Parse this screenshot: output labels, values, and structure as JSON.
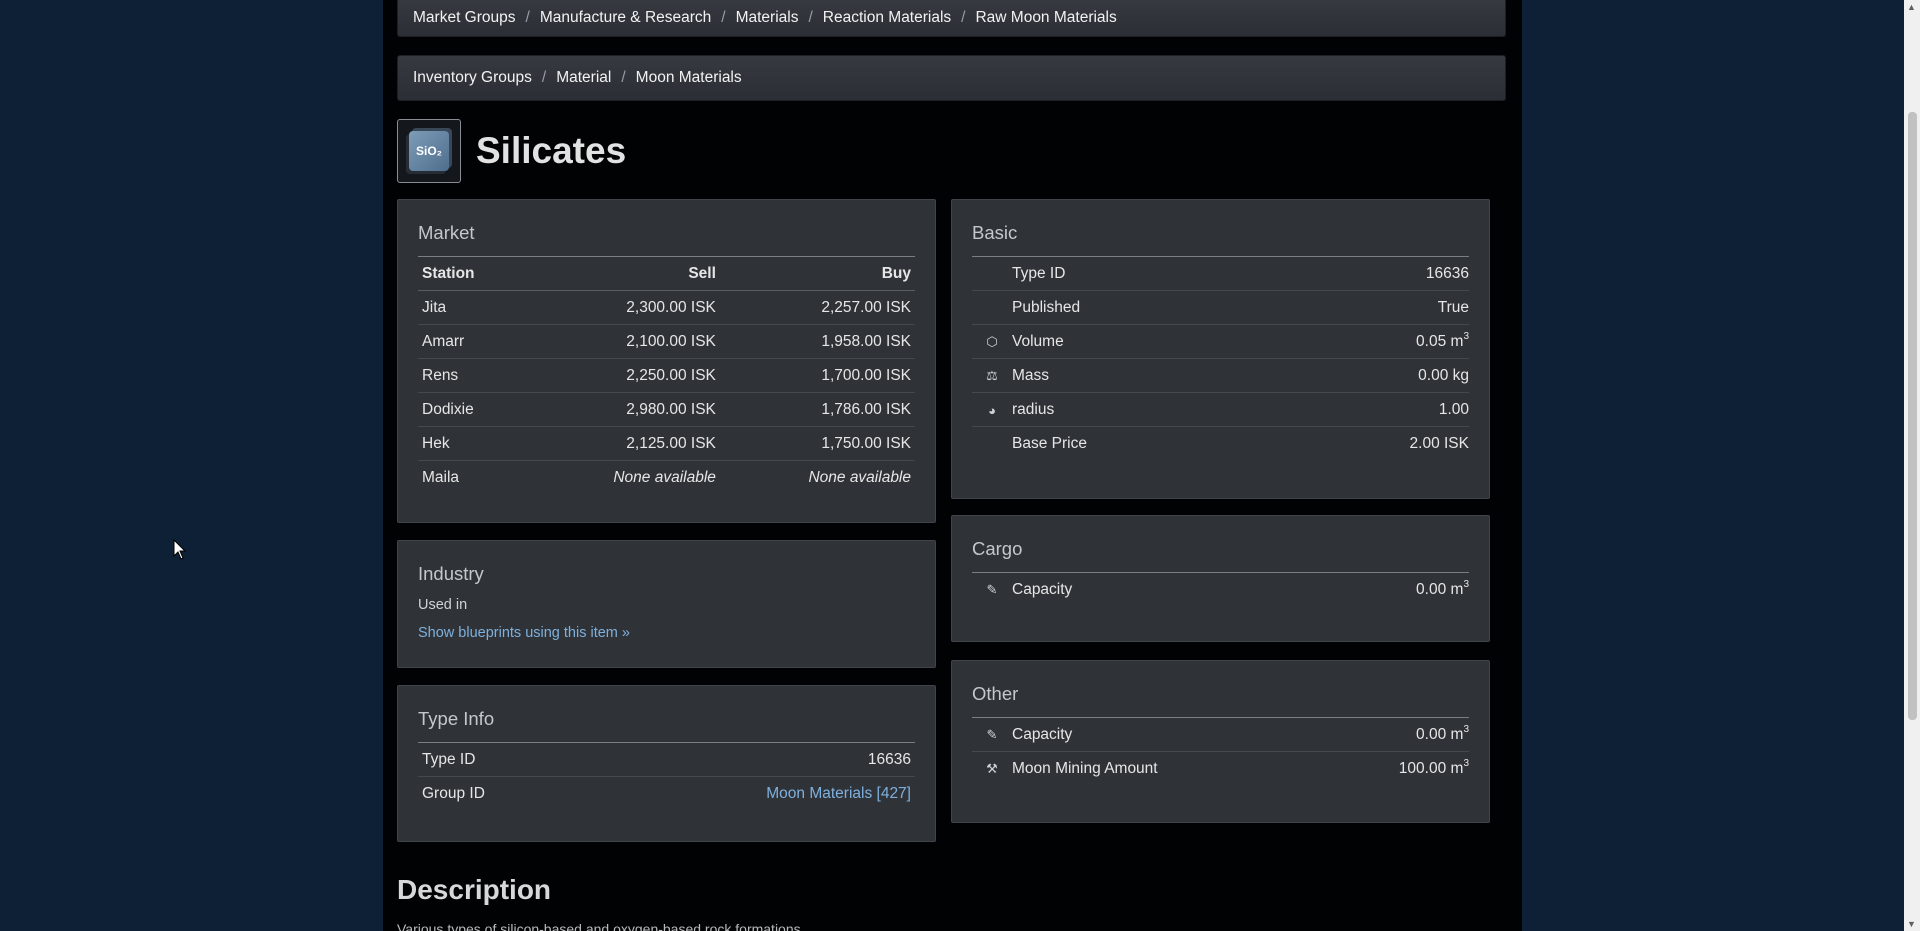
{
  "breadcrumb_market": [
    "Market Groups",
    "Manufacture & Research",
    "Materials",
    "Reaction Materials",
    "Raw Moon Materials"
  ],
  "breadcrumb_inventory": [
    "Inventory Groups",
    "Material",
    "Moon Materials"
  ],
  "item": {
    "title": "Silicates",
    "icon_label": "SiO₂"
  },
  "market": {
    "heading": "Market",
    "columns": {
      "station": "Station",
      "sell": "Sell",
      "buy": "Buy"
    },
    "rows": [
      {
        "station": "Jita",
        "sell": "2,300.00 ISK",
        "buy": "2,257.00 ISK"
      },
      {
        "station": "Amarr",
        "sell": "2,100.00 ISK",
        "buy": "1,958.00 ISK"
      },
      {
        "station": "Rens",
        "sell": "2,250.00 ISK",
        "buy": "1,700.00 ISK"
      },
      {
        "station": "Dodixie",
        "sell": "2,980.00 ISK",
        "buy": "1,786.00 ISK"
      },
      {
        "station": "Hek",
        "sell": "2,125.00 ISK",
        "buy": "1,750.00 ISK"
      },
      {
        "station": "Maila",
        "sell": "None available",
        "buy": "None available"
      }
    ]
  },
  "industry": {
    "heading": "Industry",
    "used_in": "Used in",
    "link": "Show blueprints using this item »"
  },
  "type_info": {
    "heading": "Type Info",
    "type_id_label": "Type ID",
    "type_id": "16636",
    "group_id_label": "Group ID",
    "group_id": "Moon Materials [427]"
  },
  "basic": {
    "heading": "Basic",
    "rows": [
      {
        "icon": "",
        "label": "Type ID",
        "value": "16636",
        "unit": ""
      },
      {
        "icon": "",
        "label": "Published",
        "value": "True",
        "unit": ""
      },
      {
        "icon": "volume-icon",
        "label": "Volume",
        "value": "0.05 m",
        "unit": "3"
      },
      {
        "icon": "mass-icon",
        "label": "Mass",
        "value": "0.00 kg",
        "unit": ""
      },
      {
        "icon": "radius-icon",
        "label": "radius",
        "value": "1.00",
        "unit": ""
      },
      {
        "icon": "",
        "label": "Base Price",
        "value": "2.00 ISK",
        "unit": ""
      }
    ]
  },
  "cargo": {
    "heading": "Cargo",
    "rows": [
      {
        "icon": "capacity-icon",
        "label": "Capacity",
        "value": "0.00 m",
        "unit": "3"
      }
    ]
  },
  "other": {
    "heading": "Other",
    "rows": [
      {
        "icon": "capacity-icon",
        "label": "Capacity",
        "value": "0.00 m",
        "unit": "3"
      },
      {
        "icon": "moon-mining-icon",
        "label": "Moon Mining Amount",
        "value": "100.00 m",
        "unit": "3"
      }
    ]
  },
  "description": {
    "heading": "Description",
    "text": "Various types of silicon-based and oxygen-based rock formations."
  },
  "colors": {
    "page_bg": "#0d2036",
    "content_bg": "#010204",
    "panel_bg": "#2f3338",
    "link": "#7fb0dd"
  }
}
